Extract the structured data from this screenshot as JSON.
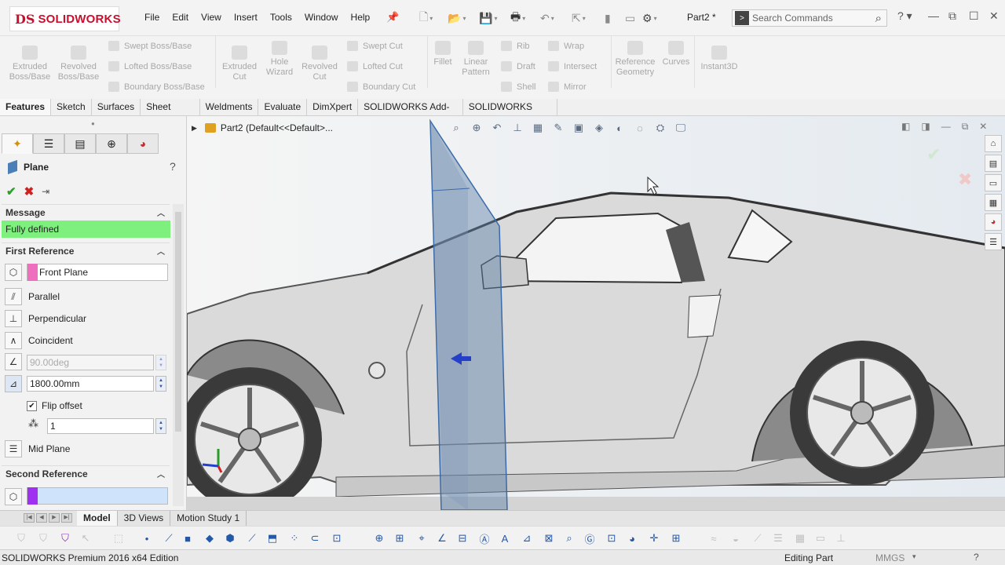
{
  "app": {
    "brand_prefix": "DS",
    "brand": "SOLIDWORKS",
    "menu": [
      "File",
      "Edit",
      "View",
      "Insert",
      "Tools",
      "Window",
      "Help"
    ],
    "document_title": "Part2 *",
    "search_placeholder": "Search Commands",
    "accent_color": "#c8102e"
  },
  "ribbon": {
    "extruded_boss": "Extruded\nBoss/Base",
    "revolved_boss": "Revolved\nBoss/Base",
    "swept_boss": "Swept Boss/Base",
    "lofted_boss": "Lofted Boss/Base",
    "boundary_boss": "Boundary Boss/Base",
    "extruded_cut": "Extruded\nCut",
    "hole_wizard": "Hole\nWizard",
    "revolved_cut": "Revolved\nCut",
    "swept_cut": "Swept Cut",
    "lofted_cut": "Lofted Cut",
    "boundary_cut": "Boundary Cut",
    "fillet": "Fillet",
    "linear_pattern": "Linear\nPattern",
    "rib": "Rib",
    "draft": "Draft",
    "shell": "Shell",
    "wrap": "Wrap",
    "intersect": "Intersect",
    "mirror": "Mirror",
    "reference_geometry": "Reference\nGeometry",
    "curves": "Curves",
    "instant3d": "Instant3D"
  },
  "command_tabs": [
    "Features",
    "Sketch",
    "Surfaces",
    "Sheet Metal",
    "Weldments",
    "Evaluate",
    "DimXpert",
    "SOLIDWORKS Add-Ins",
    "SOLIDWORKS MBD"
  ],
  "property_manager": {
    "title": "Plane",
    "help": "?",
    "message_header": "Message",
    "message_text": "Fully defined",
    "message_color": "#7df07d",
    "first_reference_header": "First Reference",
    "first_reference_value": "Front Plane",
    "first_reference_color": "#ef6fbf",
    "options": [
      "Parallel",
      "Perpendicular",
      "Coincident"
    ],
    "angle_value": "90.00deg",
    "offset_value": "1800.00mm",
    "flip_offset_label": "Flip offset",
    "flip_offset_checked": true,
    "instances_value": "1",
    "mid_plane_label": "Mid Plane",
    "second_reference_header": "Second Reference",
    "second_reference_value": "",
    "second_reference_color": "#a030f0"
  },
  "feature_tree": {
    "item": "Part2  (Default<<Default>..."
  },
  "bottom_tabs": [
    "Model",
    "3D Views",
    "Motion Study 1"
  ],
  "status": {
    "edition": "SOLIDWORKS Premium 2016 x64 Edition",
    "mode": "Editing Part",
    "units": "MMGS",
    "dropdown": "▾",
    "help": "?"
  }
}
